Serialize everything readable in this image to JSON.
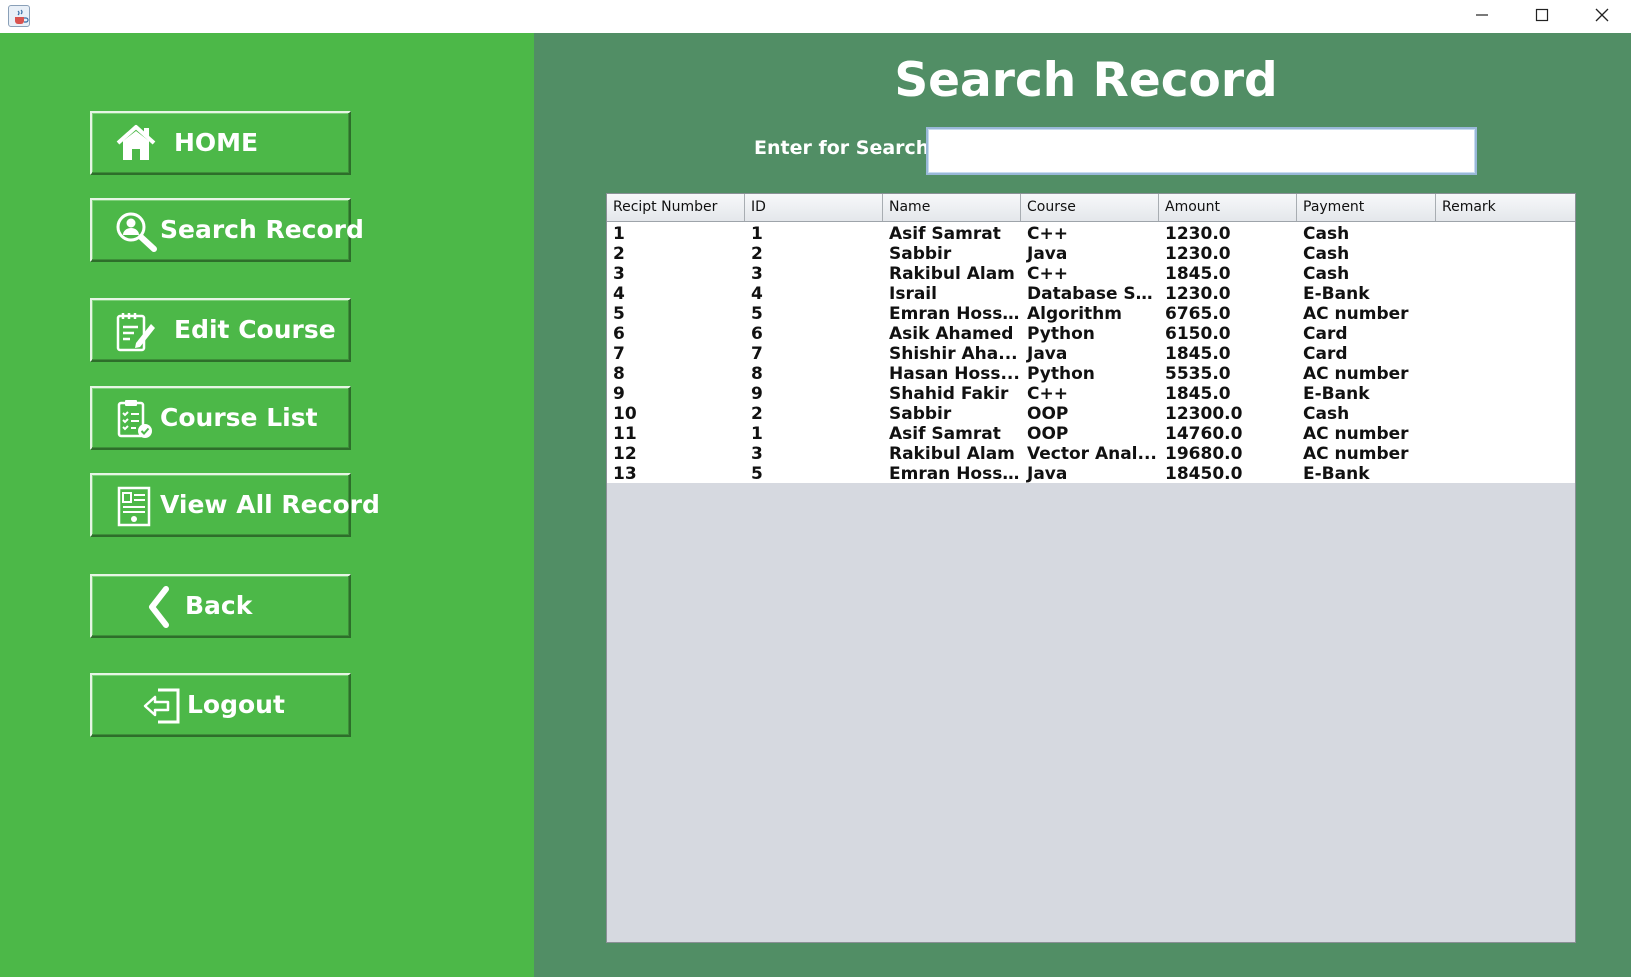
{
  "window": {
    "controls": {
      "minimize": "–",
      "maximize": "☐",
      "close": "✕"
    },
    "icon": "java-cup-icon"
  },
  "sidebar": {
    "buttons": [
      {
        "label": "HOME",
        "icon": "home-icon"
      },
      {
        "label": "Search Record",
        "icon": "search-record-icon"
      },
      {
        "label": "Edit Course",
        "icon": "edit-course-icon"
      },
      {
        "label": "Course List",
        "icon": "course-list-icon"
      },
      {
        "label": "View All Record",
        "icon": "view-record-icon"
      },
      {
        "label": "Back",
        "icon": "chevron-left-icon"
      },
      {
        "label": "Logout",
        "icon": "logout-icon"
      }
    ]
  },
  "main": {
    "title": "Search Record",
    "search": {
      "label": "Enter for Search :",
      "value": ""
    },
    "table": {
      "columns": [
        "Recipt Number",
        "ID",
        "Name",
        "Course",
        "Amount",
        "Payment",
        "Remark"
      ],
      "rows": [
        [
          "1",
          "1",
          "Asif Samrat",
          "C++",
          "1230.0",
          "Cash",
          ""
        ],
        [
          "2",
          "2",
          "Sabbir",
          "Java",
          "1230.0",
          "Cash",
          ""
        ],
        [
          "3",
          "3",
          "Rakibul Alam",
          "C++",
          "1845.0",
          "Cash",
          ""
        ],
        [
          "4",
          "4",
          "Israil",
          "Database Sy...",
          "1230.0",
          "E-Bank",
          ""
        ],
        [
          "5",
          "5",
          "Emran Hoss...",
          "Algorithm",
          "6765.0",
          "AC number",
          ""
        ],
        [
          "6",
          "6",
          "Asik Ahamed",
          "Python",
          "6150.0",
          "Card",
          ""
        ],
        [
          "7",
          "7",
          "Shishir Aha...",
          "Java",
          "1845.0",
          "Card",
          ""
        ],
        [
          "8",
          "8",
          "Hasan Hoss...",
          "Python",
          "5535.0",
          "AC number",
          ""
        ],
        [
          "9",
          "9",
          "Shahid Fakir",
          "C++",
          "1845.0",
          "E-Bank",
          ""
        ],
        [
          "10",
          "2",
          "Sabbir",
          "OOP",
          "12300.0",
          "Cash",
          ""
        ],
        [
          "11",
          "1",
          "Asif Samrat",
          "OOP",
          "14760.0",
          "AC number",
          ""
        ],
        [
          "12",
          "3",
          "Rakibul Alam",
          "Vector Anal...",
          "19680.0",
          "AC number",
          ""
        ],
        [
          "13",
          "5",
          "Emran Hoss...",
          "Java",
          "18450.0",
          "E-Bank",
          ""
        ]
      ]
    }
  },
  "colors": {
    "sidebar_bg": "#4cb848",
    "main_bg": "#518e65",
    "table_empty_bg": "#d6d9e0",
    "text_light": "#ffffff"
  }
}
